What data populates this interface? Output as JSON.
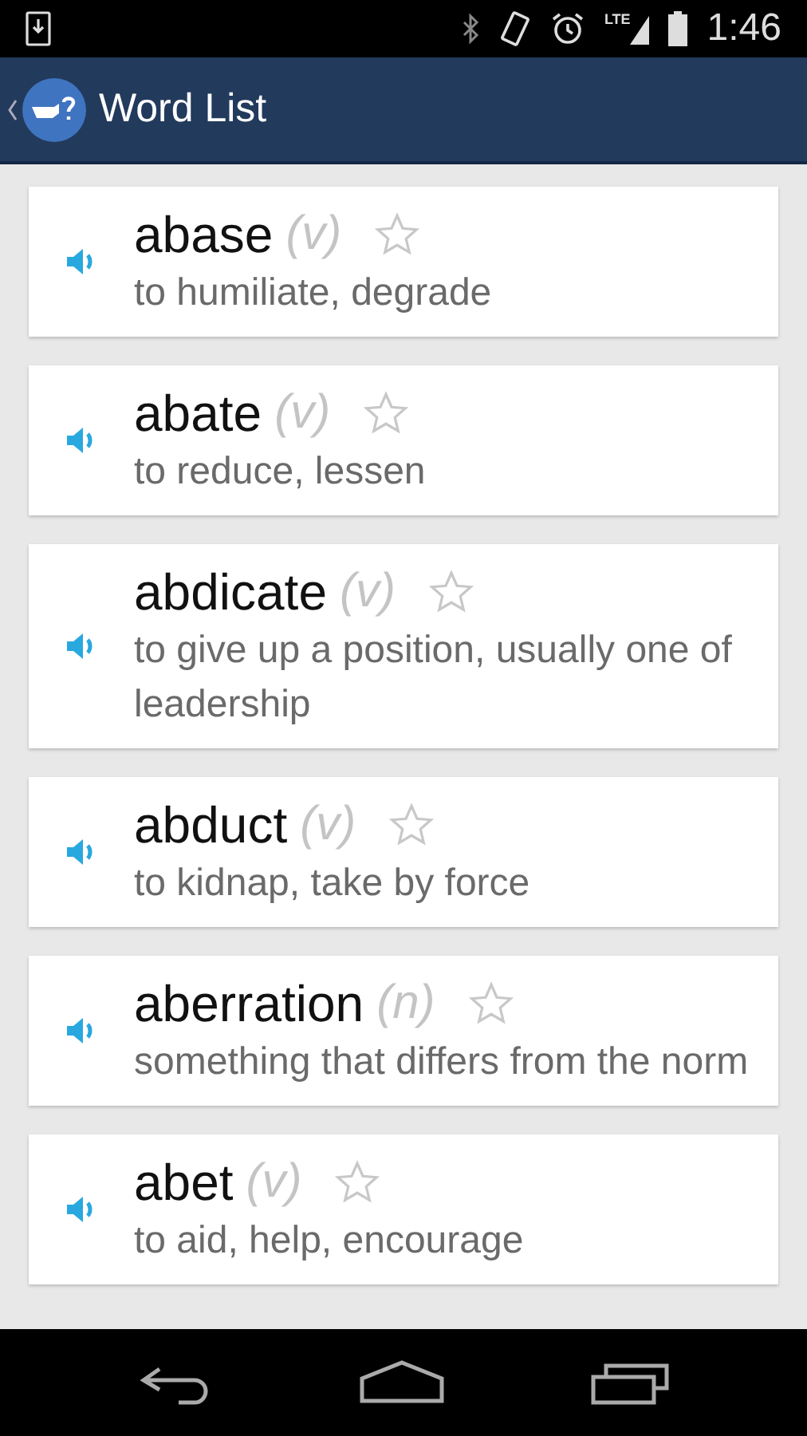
{
  "status_bar": {
    "network": "LTE",
    "time": "1:46"
  },
  "header": {
    "title": "Word List"
  },
  "words": [
    {
      "word": "abase",
      "pos": "(v)",
      "definition": "to humiliate, degrade",
      "starred": false
    },
    {
      "word": "abate",
      "pos": "(v)",
      "definition": "to reduce, lessen",
      "starred": false
    },
    {
      "word": "abdicate",
      "pos": "(v)",
      "definition": "to give up a position, usually one of leadership",
      "starred": false
    },
    {
      "word": "abduct",
      "pos": "(v)",
      "definition": "to kidnap, take by force",
      "starred": false
    },
    {
      "word": "aberration",
      "pos": "(n)",
      "definition": "something that differs from the norm",
      "starred": false
    },
    {
      "word": "abet",
      "pos": "(v)",
      "definition": "to aid, help, encourage",
      "starred": false
    }
  ]
}
